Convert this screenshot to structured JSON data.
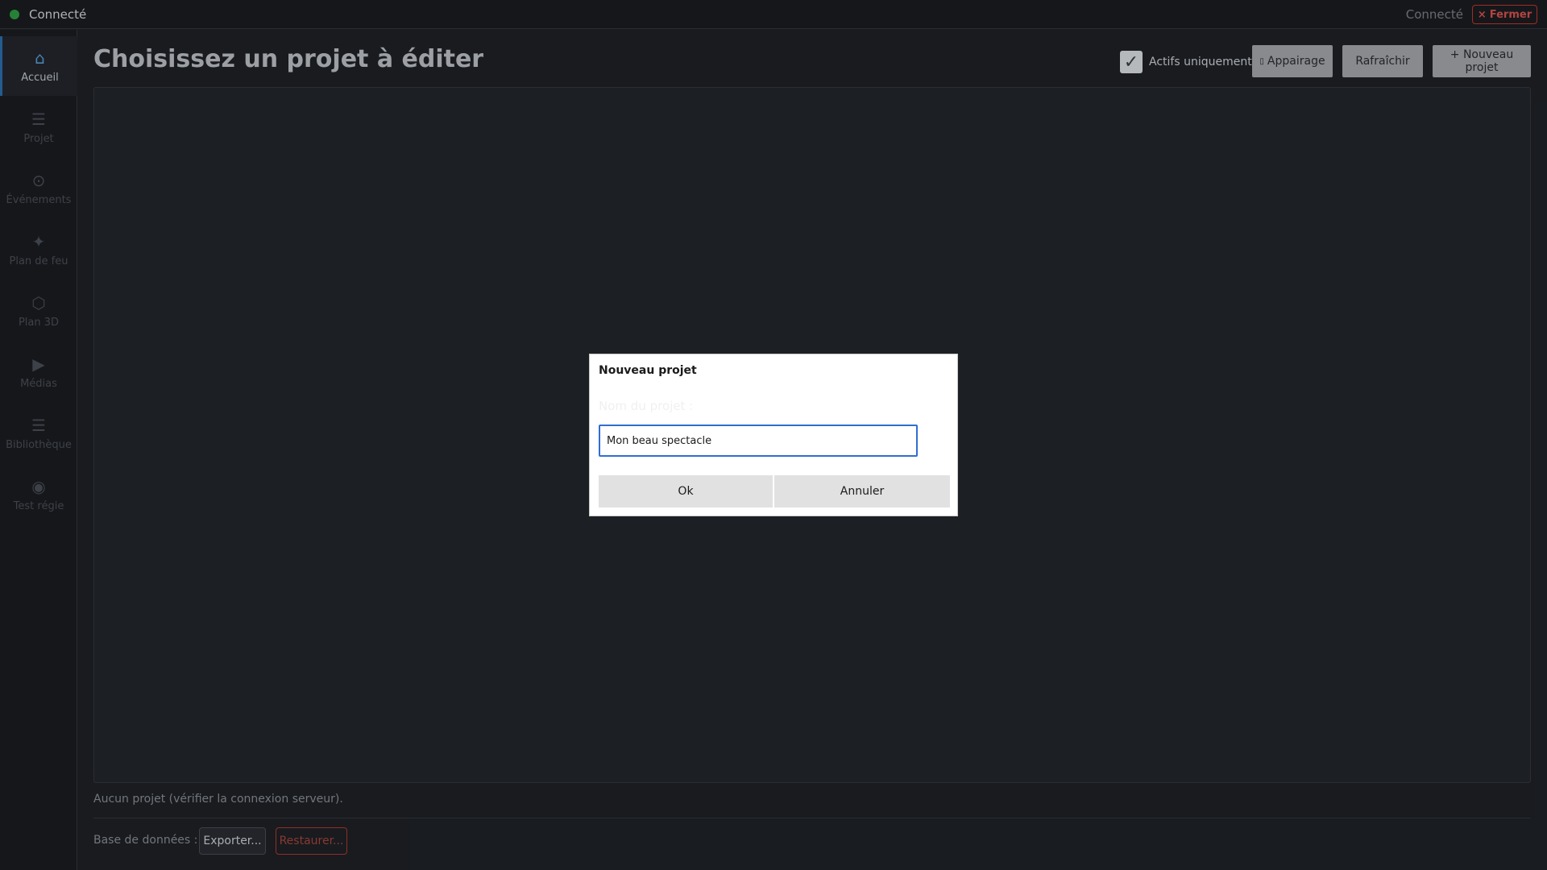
{
  "topbar": {
    "status_label": "Connecté",
    "status_right": "Connecté",
    "close_label": "Fermer",
    "close_icon": "×"
  },
  "sidebar": {
    "items": [
      {
        "label": "Accueil",
        "icon": "⌂",
        "icon_name": "home-icon",
        "active": true
      },
      {
        "label": "Projet",
        "icon": "☰",
        "icon_name": "list-icon",
        "active": false
      },
      {
        "label": "Événements",
        "icon": "⊙",
        "icon_name": "target-icon",
        "active": false
      },
      {
        "label": "Plan de feu",
        "icon": "✦",
        "icon_name": "sparkle-icon",
        "active": false
      },
      {
        "label": "Plan 3D",
        "icon": "⬡",
        "icon_name": "cube-icon",
        "active": false
      },
      {
        "label": "Médias",
        "icon": "▶",
        "icon_name": "play-icon",
        "active": false
      },
      {
        "label": "Bibliothèque",
        "icon": "☰",
        "icon_name": "library-icon",
        "active": false
      },
      {
        "label": "Test régie",
        "icon": "◉",
        "icon_name": "radio-icon",
        "active": false
      }
    ]
  },
  "header": {
    "title": "Choisissez un projet à éditer",
    "active_only_label": "Actifs uniquement",
    "active_only_checked": true,
    "pairing_label": "Appairage",
    "pairing_icon": "▯",
    "refresh_label": "Rafraîchir",
    "new_project_label": "+ Nouveau projet"
  },
  "main": {
    "empty_message": "Aucun projet (vérifier la connexion serveur).",
    "db_label": "Base de données :",
    "export_label": "Exporter...",
    "restore_label": "Restaurer..."
  },
  "dialog": {
    "title": "Nouveau projet",
    "field_label": "Nom du projet :",
    "input_value": "Mon beau spectacle",
    "ok_label": "Ok",
    "cancel_label": "Annuler"
  },
  "colors": {
    "accent": "#2f6fd1",
    "danger": "#c0392b",
    "connected": "#2f9e44",
    "background": "#1f2227"
  }
}
